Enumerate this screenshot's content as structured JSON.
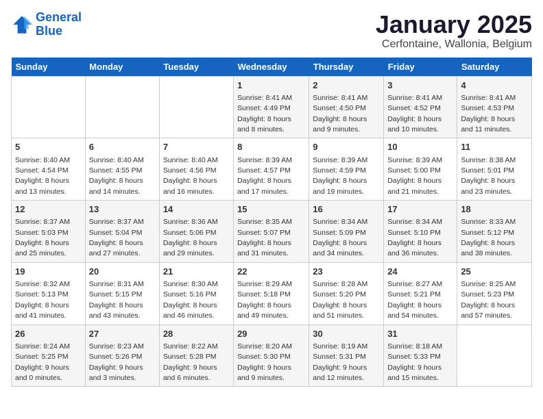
{
  "logo": {
    "line1": "General",
    "line2": "Blue"
  },
  "title": "January 2025",
  "location": "Cerfontaine, Wallonia, Belgium",
  "weekdays": [
    "Sunday",
    "Monday",
    "Tuesday",
    "Wednesday",
    "Thursday",
    "Friday",
    "Saturday"
  ],
  "weeks": [
    [
      {
        "day": "",
        "info": ""
      },
      {
        "day": "",
        "info": ""
      },
      {
        "day": "",
        "info": ""
      },
      {
        "day": "1",
        "info": "Sunrise: 8:41 AM\nSunset: 4:49 PM\nDaylight: 8 hours and 8 minutes."
      },
      {
        "day": "2",
        "info": "Sunrise: 8:41 AM\nSunset: 4:50 PM\nDaylight: 8 hours and 9 minutes."
      },
      {
        "day": "3",
        "info": "Sunrise: 8:41 AM\nSunset: 4:52 PM\nDaylight: 8 hours and 10 minutes."
      },
      {
        "day": "4",
        "info": "Sunrise: 8:41 AM\nSunset: 4:53 PM\nDaylight: 8 hours and 11 minutes."
      }
    ],
    [
      {
        "day": "5",
        "info": "Sunrise: 8:40 AM\nSunset: 4:54 PM\nDaylight: 8 hours and 13 minutes."
      },
      {
        "day": "6",
        "info": "Sunrise: 8:40 AM\nSunset: 4:55 PM\nDaylight: 8 hours and 14 minutes."
      },
      {
        "day": "7",
        "info": "Sunrise: 8:40 AM\nSunset: 4:56 PM\nDaylight: 8 hours and 16 minutes."
      },
      {
        "day": "8",
        "info": "Sunrise: 8:39 AM\nSunset: 4:57 PM\nDaylight: 8 hours and 17 minutes."
      },
      {
        "day": "9",
        "info": "Sunrise: 8:39 AM\nSunset: 4:59 PM\nDaylight: 8 hours and 19 minutes."
      },
      {
        "day": "10",
        "info": "Sunrise: 8:39 AM\nSunset: 5:00 PM\nDaylight: 8 hours and 21 minutes."
      },
      {
        "day": "11",
        "info": "Sunrise: 8:38 AM\nSunset: 5:01 PM\nDaylight: 8 hours and 23 minutes."
      }
    ],
    [
      {
        "day": "12",
        "info": "Sunrise: 8:37 AM\nSunset: 5:03 PM\nDaylight: 8 hours and 25 minutes."
      },
      {
        "day": "13",
        "info": "Sunrise: 8:37 AM\nSunset: 5:04 PM\nDaylight: 8 hours and 27 minutes."
      },
      {
        "day": "14",
        "info": "Sunrise: 8:36 AM\nSunset: 5:06 PM\nDaylight: 8 hours and 29 minutes."
      },
      {
        "day": "15",
        "info": "Sunrise: 8:35 AM\nSunset: 5:07 PM\nDaylight: 8 hours and 31 minutes."
      },
      {
        "day": "16",
        "info": "Sunrise: 8:34 AM\nSunset: 5:09 PM\nDaylight: 8 hours and 34 minutes."
      },
      {
        "day": "17",
        "info": "Sunrise: 8:34 AM\nSunset: 5:10 PM\nDaylight: 8 hours and 36 minutes."
      },
      {
        "day": "18",
        "info": "Sunrise: 8:33 AM\nSunset: 5:12 PM\nDaylight: 8 hours and 38 minutes."
      }
    ],
    [
      {
        "day": "19",
        "info": "Sunrise: 8:32 AM\nSunset: 5:13 PM\nDaylight: 8 hours and 41 minutes."
      },
      {
        "day": "20",
        "info": "Sunrise: 8:31 AM\nSunset: 5:15 PM\nDaylight: 8 hours and 43 minutes."
      },
      {
        "day": "21",
        "info": "Sunrise: 8:30 AM\nSunset: 5:16 PM\nDaylight: 8 hours and 46 minutes."
      },
      {
        "day": "22",
        "info": "Sunrise: 8:29 AM\nSunset: 5:18 PM\nDaylight: 8 hours and 49 minutes."
      },
      {
        "day": "23",
        "info": "Sunrise: 8:28 AM\nSunset: 5:20 PM\nDaylight: 8 hours and 51 minutes."
      },
      {
        "day": "24",
        "info": "Sunrise: 8:27 AM\nSunset: 5:21 PM\nDaylight: 8 hours and 54 minutes."
      },
      {
        "day": "25",
        "info": "Sunrise: 8:25 AM\nSunset: 5:23 PM\nDaylight: 8 hours and 57 minutes."
      }
    ],
    [
      {
        "day": "26",
        "info": "Sunrise: 8:24 AM\nSunset: 5:25 PM\nDaylight: 9 hours and 0 minutes."
      },
      {
        "day": "27",
        "info": "Sunrise: 8:23 AM\nSunset: 5:26 PM\nDaylight: 9 hours and 3 minutes."
      },
      {
        "day": "28",
        "info": "Sunrise: 8:22 AM\nSunset: 5:28 PM\nDaylight: 9 hours and 6 minutes."
      },
      {
        "day": "29",
        "info": "Sunrise: 8:20 AM\nSunset: 5:30 PM\nDaylight: 9 hours and 9 minutes."
      },
      {
        "day": "30",
        "info": "Sunrise: 8:19 AM\nSunset: 5:31 PM\nDaylight: 9 hours and 12 minutes."
      },
      {
        "day": "31",
        "info": "Sunrise: 8:18 AM\nSunset: 5:33 PM\nDaylight: 9 hours and 15 minutes."
      },
      {
        "day": "",
        "info": ""
      }
    ]
  ]
}
